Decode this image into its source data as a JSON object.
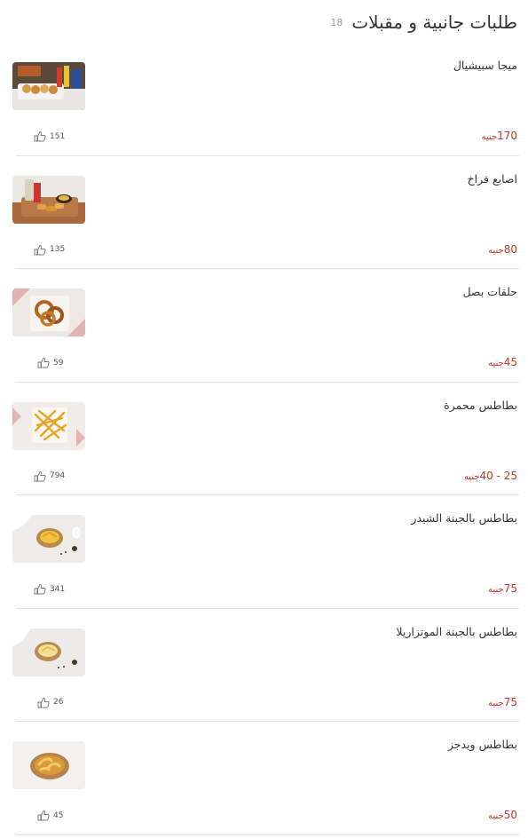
{
  "category": {
    "title": "طلبات جانبية و مقبلات",
    "count": "18"
  },
  "currency": "جنيه",
  "items": [
    {
      "name": "ميجا سبيشيال",
      "price": "170",
      "likes": "151",
      "icon": "mega-special-photo"
    },
    {
      "name": "اصابع فراخ",
      "price": "80",
      "likes": "135",
      "icon": "chicken-fingers-photo"
    },
    {
      "name": "حلقات بصل",
      "price": "45",
      "likes": "59",
      "icon": "onion-rings-photo"
    },
    {
      "name": "بطاطس محمرة",
      "price": "25 - 40",
      "likes": "794",
      "icon": "french-fries-photo"
    },
    {
      "name": "بطاطس بالجبنة الشيدر",
      "price": "75",
      "likes": "341",
      "icon": "cheddar-fries-photo"
    },
    {
      "name": "بطاطس بالجبنة الموتزاريلا",
      "price": "75",
      "likes": "26",
      "icon": "mozzarella-fries-photo"
    },
    {
      "name": "بطاطس ويدجز",
      "price": "50",
      "likes": "45",
      "icon": "wedges-photo"
    }
  ]
}
